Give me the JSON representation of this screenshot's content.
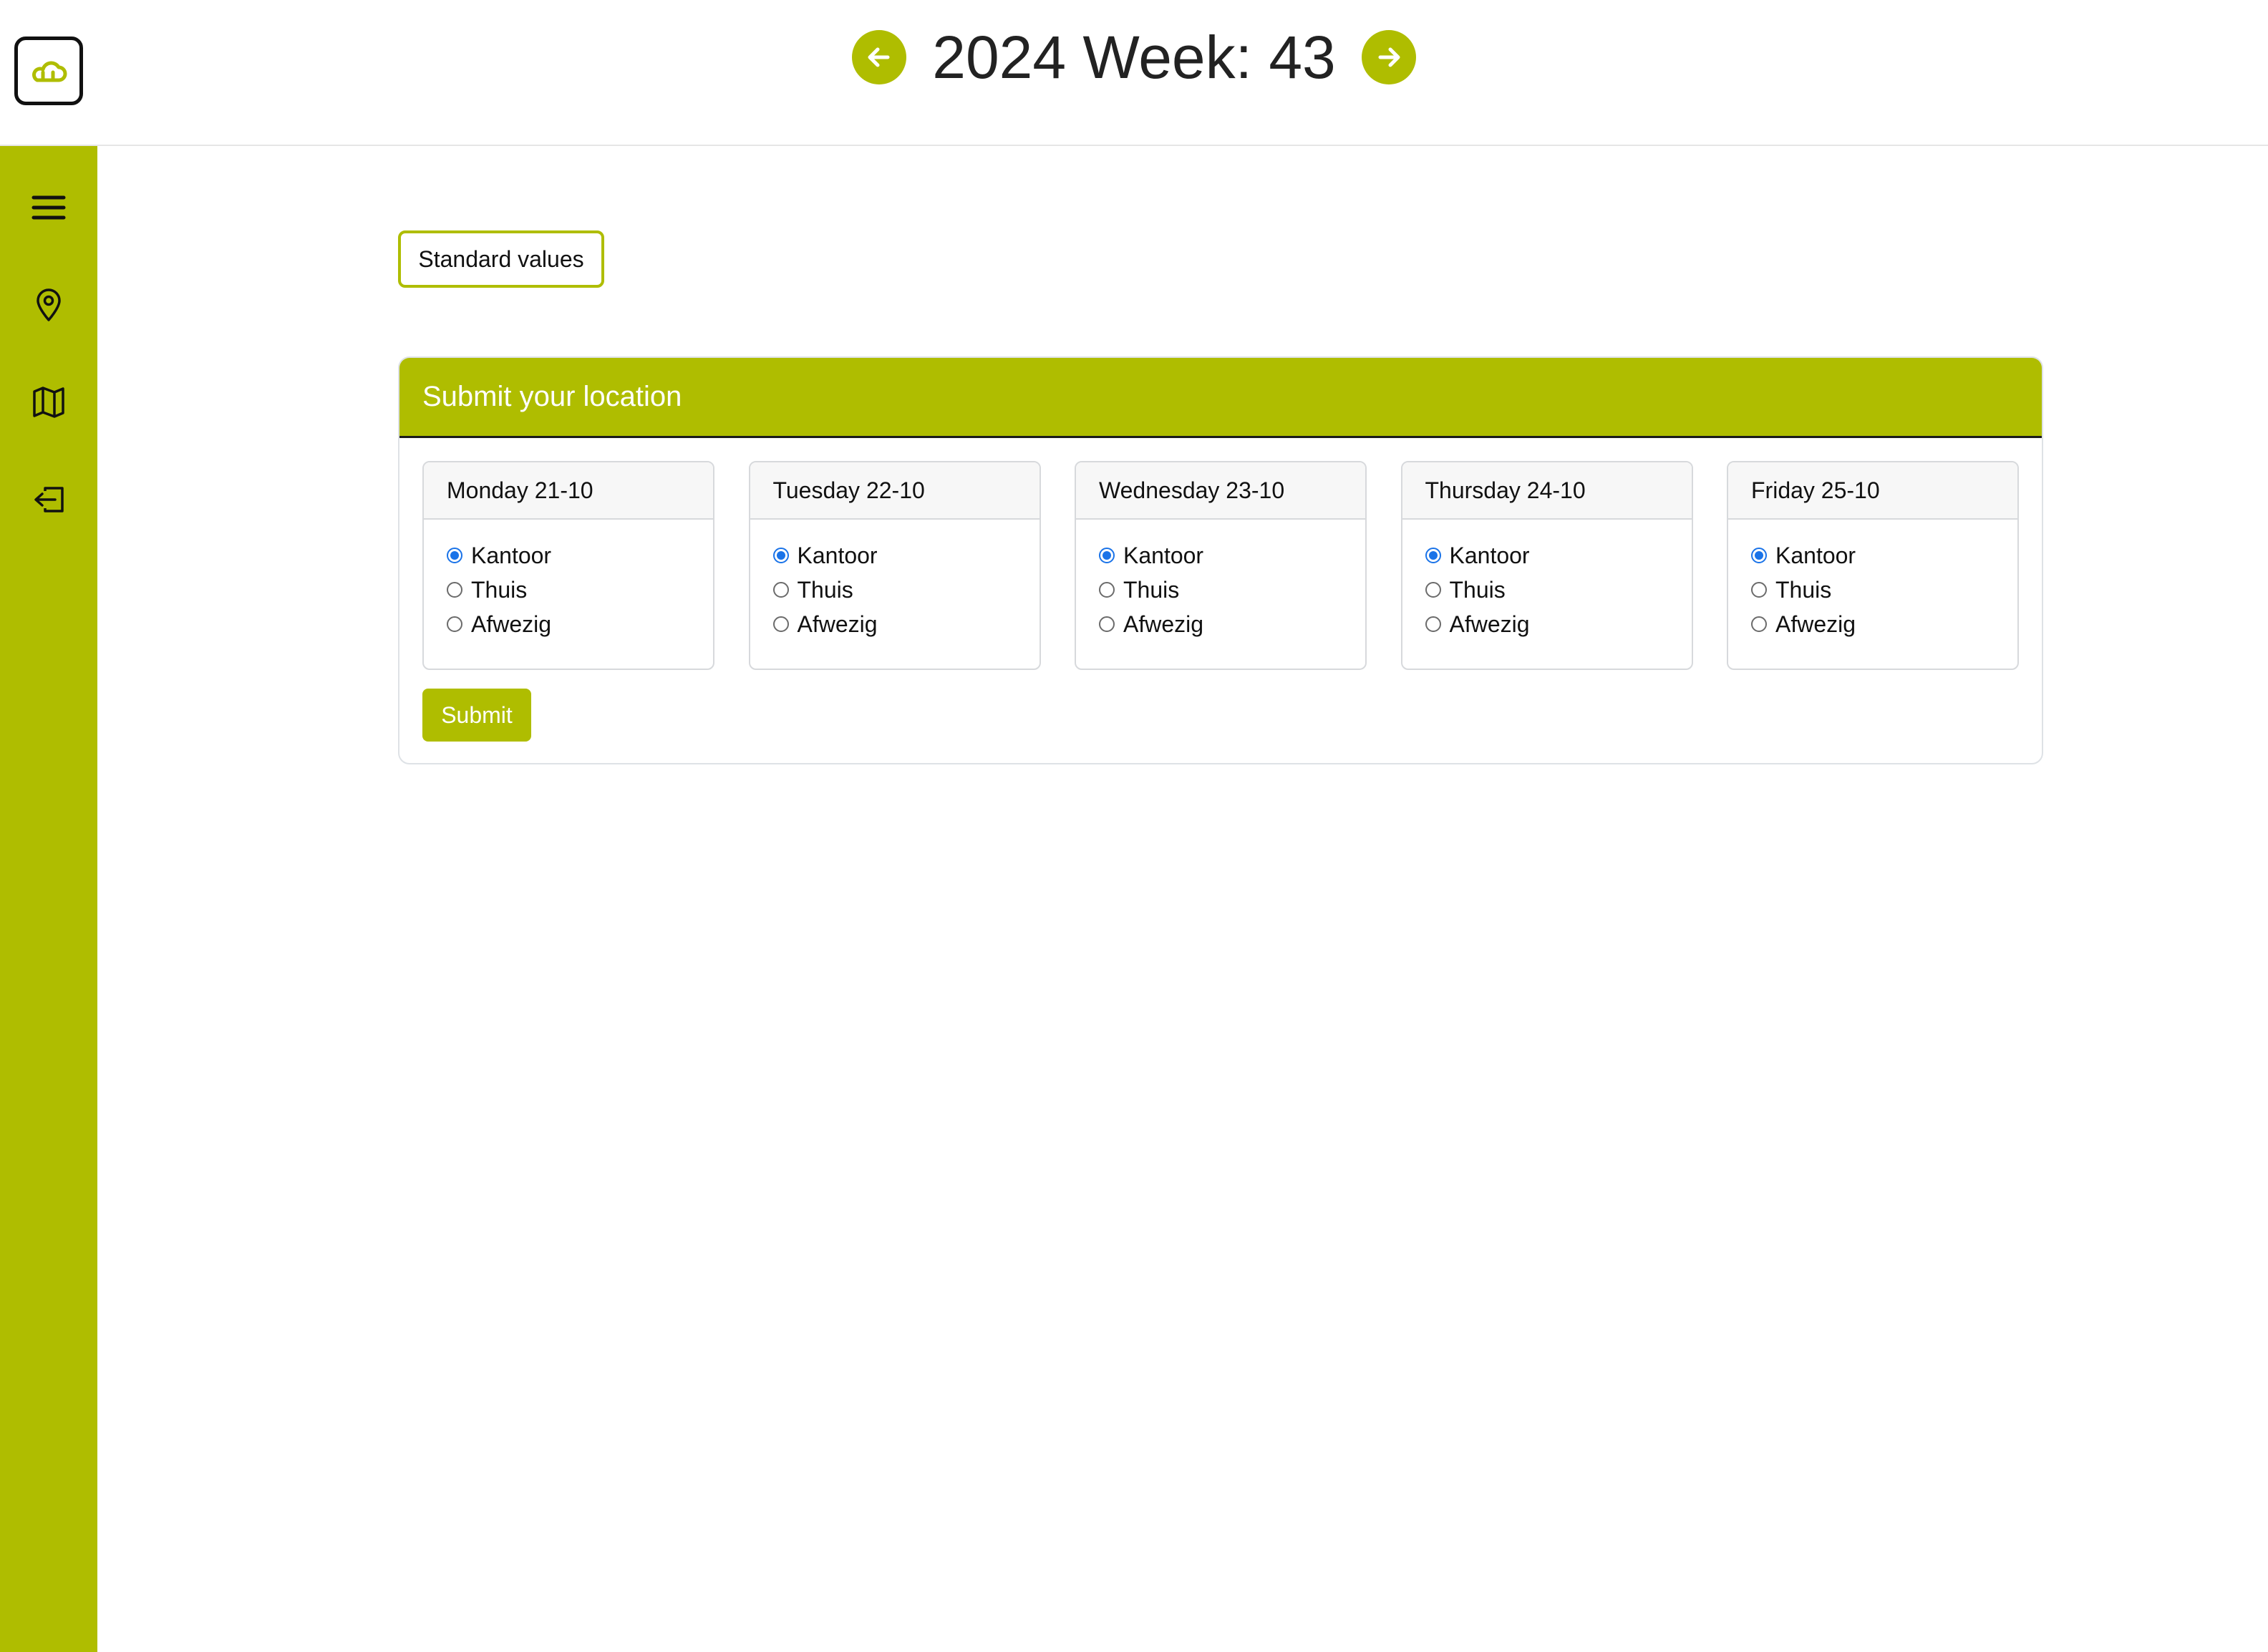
{
  "header": {
    "title": "2024 Week: 43",
    "prev_icon": "arrow-left-icon",
    "next_icon": "arrow-right-icon",
    "logo_icon": "cloud-logo-icon"
  },
  "sidebar": {
    "items": [
      {
        "name": "menu",
        "icon": "hamburger-menu-icon"
      },
      {
        "name": "location",
        "icon": "map-pin-icon"
      },
      {
        "name": "map",
        "icon": "map-icon"
      },
      {
        "name": "logout",
        "icon": "logout-icon"
      }
    ]
  },
  "standard_values_label": "Standard values",
  "form": {
    "title": "Submit your location",
    "submit_label": "Submit",
    "days": [
      {
        "label": "Monday 21-10",
        "selected": "Kantoor"
      },
      {
        "label": "Tuesday 22-10",
        "selected": "Kantoor"
      },
      {
        "label": "Wednesday 23-10",
        "selected": "Kantoor"
      },
      {
        "label": "Thursday 24-10",
        "selected": "Kantoor"
      },
      {
        "label": "Friday 25-10",
        "selected": "Kantoor"
      }
    ],
    "options": [
      "Kantoor",
      "Thuis",
      "Afwezig"
    ]
  },
  "colors": {
    "accent": "#afbd00",
    "radio_checked": "#1a73e8"
  }
}
